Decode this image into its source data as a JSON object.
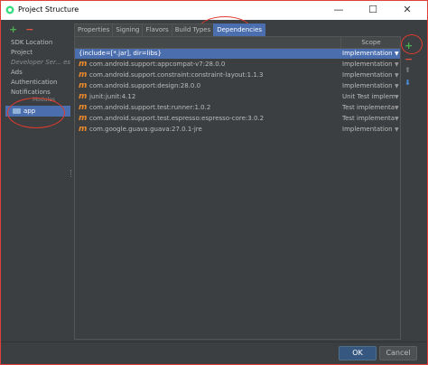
{
  "window": {
    "title": "Project Structure",
    "minimize": "—",
    "maximize": "☐",
    "close": "✕"
  },
  "sidebar": {
    "add": "+",
    "remove": "−",
    "items": [
      "SDK Location",
      "Project",
      "Developer Ser... es",
      "Ads",
      "Authentication",
      "Notifications"
    ],
    "modules_label": "Modules",
    "app_label": "app"
  },
  "tabs": [
    "Properties",
    "Signing",
    "Flavors",
    "Build Types",
    "Dependencies"
  ],
  "table": {
    "scope_header": "Scope",
    "rows": [
      {
        "name": "{include=[*.jar], dir=libs}",
        "scope": "Implementation",
        "maven": ""
      },
      {
        "name": "com.android.support:appcompat-v7:28.0.0",
        "scope": "Implementation",
        "maven": "m"
      },
      {
        "name": "com.android.support.constraint:constraint-layout:1.1.3",
        "scope": "Implementation",
        "maven": "m"
      },
      {
        "name": "com.android.support:design:28.0.0",
        "scope": "Implementation",
        "maven": "m"
      },
      {
        "name": "junit:junit:4.12",
        "scope": "Unit Test impleme...",
        "maven": "m"
      },
      {
        "name": "com.android.support.test:runner:1.0.2",
        "scope": "Test implementation",
        "maven": "m"
      },
      {
        "name": "com.android.support.test.espresso:espresso-core:3.0.2",
        "scope": "Test implementation",
        "maven": "m"
      },
      {
        "name": "com.google.guava:guava:27.0.1-jre",
        "scope": "Implementation",
        "maven": "m"
      }
    ]
  },
  "side_tools": {
    "add": "+",
    "remove": "−",
    "move_down": "⬇"
  },
  "buttons": {
    "ok": "OK",
    "cancel": "Cancel"
  },
  "colors": {
    "accent": "#4b6eaf",
    "annotation": "#e33a2e",
    "maven_icon": "#e8892b"
  }
}
